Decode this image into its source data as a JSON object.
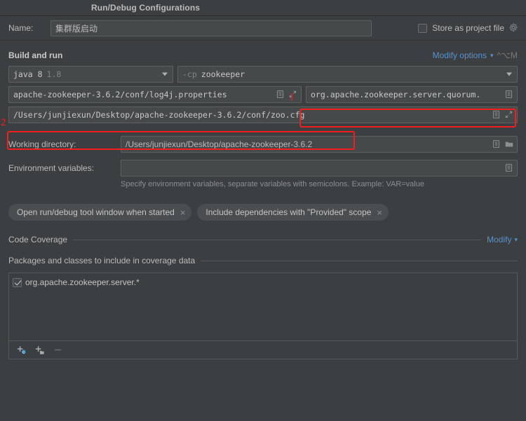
{
  "window": {
    "title": "Run/Debug Configurations"
  },
  "name_row": {
    "label": "Name:",
    "value": "集群版启动",
    "store_as_project_file": "Store as project file",
    "store_checked": false,
    "gear_icon": "gear-icon"
  },
  "build_and_run": {
    "title": "Build and run",
    "modify_options_label": "Modify options",
    "modify_options_shortcut": "^⌥M",
    "jdk": {
      "name": "java 8",
      "version": "1.8"
    },
    "classpath": {
      "flag": "-cp",
      "module": "zookeeper"
    },
    "vm_options": {
      "value": "apache-zookeeper-3.6.2/conf/log4j.properties",
      "icons": [
        "list-icon",
        "expand-icon"
      ]
    },
    "main_class": {
      "value": "org.apache.zookeeper.server.quorum.",
      "icons": [
        "list-icon"
      ]
    },
    "program_arguments": {
      "value": "/Users/junjiexun/Desktop/apache-zookeeper-3.6.2/conf/zoo.cfg",
      "icons": [
        "list-icon",
        "expand-icon"
      ]
    }
  },
  "annotations": [
    {
      "number": "1"
    },
    {
      "number": "2"
    }
  ],
  "working_directory": {
    "label": "Working directory:",
    "value": "/Users/junjiexun/Desktop/apache-zookeeper-3.6.2",
    "icons": [
      "list-icon",
      "folder-icon"
    ]
  },
  "environment_variables": {
    "label": "Environment variables:",
    "value": "",
    "placeholder": "",
    "hint": "Specify environment variables, separate variables with semicolons. Example: VAR=value",
    "icons": [
      "list-icon"
    ]
  },
  "chips": [
    {
      "label": "Open run/debug tool window when started",
      "close": "×"
    },
    {
      "label": "Include dependencies with \"Provided\" scope",
      "close": "×"
    }
  ],
  "code_coverage": {
    "title": "Code Coverage",
    "modify_label": "Modify"
  },
  "packages_section": {
    "title": "Packages and classes to include in coverage data",
    "items": [
      {
        "label": "org.apache.zookeeper.server.*",
        "checked": true
      }
    ],
    "tools": [
      {
        "name": "add-class-button",
        "icon": "plus-class-icon",
        "enabled": true
      },
      {
        "name": "add-package-button",
        "icon": "plus-package-icon",
        "enabled": true
      },
      {
        "name": "remove-button",
        "icon": "minus-icon",
        "enabled": false
      }
    ]
  },
  "colors": {
    "background": "#3c3f41",
    "field": "#45494a",
    "accent_link": "#5890cb",
    "annotation_red": "#f02020",
    "text": "#bbbbbb"
  }
}
